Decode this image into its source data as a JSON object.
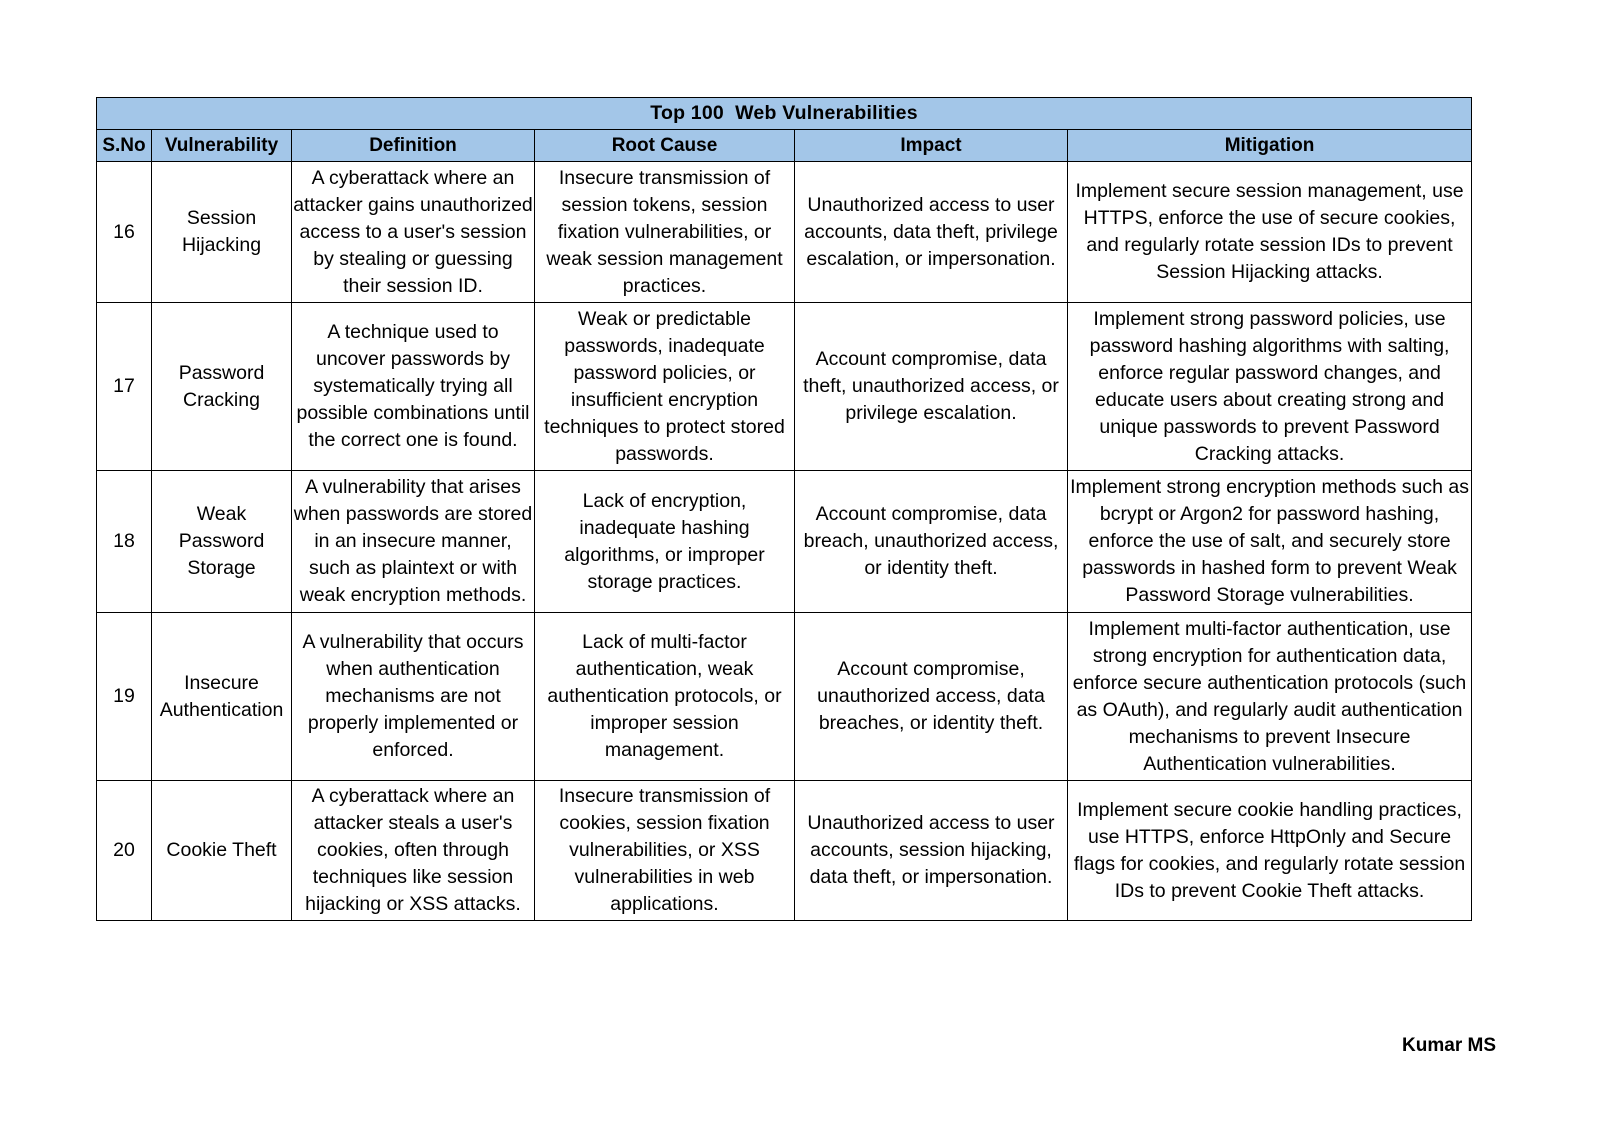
{
  "document": {
    "title": "Top 100  Web Vulnerabilities",
    "footer": "Kumar MS",
    "accent_color": "#A3C6E8",
    "border_color": "#000000",
    "text_color": "#000000"
  },
  "table": {
    "columns": [
      {
        "key": "sno",
        "label": "S.No"
      },
      {
        "key": "name",
        "label": "Vulnerability"
      },
      {
        "key": "def",
        "label": "Definition"
      },
      {
        "key": "root",
        "label": "Root Cause"
      },
      {
        "key": "impact",
        "label": "Impact"
      },
      {
        "key": "mit",
        "label": "Mitigation"
      }
    ],
    "rows": [
      {
        "sno": "16",
        "name": "Session Hijacking",
        "def": "A cyberattack where an attacker gains unauthorized access to a user's session by stealing or guessing their session ID.",
        "root": "Insecure transmission of session tokens, session fixation vulnerabilities, or weak session management practices.",
        "impact": "Unauthorized access to user accounts, data theft, privilege escalation, or impersonation.",
        "mit": "Implement secure session management, use HTTPS, enforce the use of secure cookies, and regularly rotate session IDs to prevent Session Hijacking attacks."
      },
      {
        "sno": "17",
        "name": "Password Cracking",
        "def": "A technique used to uncover passwords by systematically trying all possible combinations until the correct one is found.",
        "root": "Weak or predictable passwords, inadequate password policies, or insufficient encryption techniques to protect stored passwords.",
        "impact": "Account compromise, data theft, unauthorized access, or privilege escalation.",
        "mit": "Implement strong password policies, use password hashing algorithms with salting, enforce regular password changes, and educate users about creating strong and unique passwords to prevent Password Cracking attacks."
      },
      {
        "sno": "18",
        "name": "Weak Password Storage",
        "def": "A vulnerability that arises when passwords are stored in an insecure manner, such as plaintext or with weak encryption methods.",
        "root": "Lack of encryption, inadequate hashing algorithms, or improper storage practices.",
        "impact": "Account compromise, data breach, unauthorized access, or identity theft.",
        "mit": "Implement strong encryption methods such as bcrypt or Argon2 for password hashing, enforce the use of salt, and securely store passwords in hashed form to prevent Weak Password Storage vulnerabilities."
      },
      {
        "sno": "19",
        "name": "Insecure Authentication",
        "def": "A vulnerability that occurs when authentication mechanisms are not properly implemented or enforced.",
        "root": "Lack of multi-factor authentication, weak authentication protocols, or improper session management.",
        "impact": "Account compromise, unauthorized access, data breaches, or identity theft.",
        "mit": "Implement multi-factor authentication, use strong encryption for authentication data, enforce secure authentication protocols (such as OAuth), and regularly audit authentication mechanisms to prevent Insecure Authentication vulnerabilities."
      },
      {
        "sno": "20",
        "name": "Cookie Theft",
        "def": "A cyberattack where an attacker steals a user's cookies, often through techniques like session hijacking or XSS attacks.",
        "root": "Insecure transmission of cookies, session fixation vulnerabilities, or XSS vulnerabilities in web applications.",
        "impact": "Unauthorized access to user accounts, session hijacking, data theft, or impersonation.",
        "mit": "Implement secure cookie handling practices, use HTTPS, enforce HttpOnly and Secure flags for cookies, and regularly rotate session IDs to prevent Cookie Theft attacks."
      }
    ]
  }
}
